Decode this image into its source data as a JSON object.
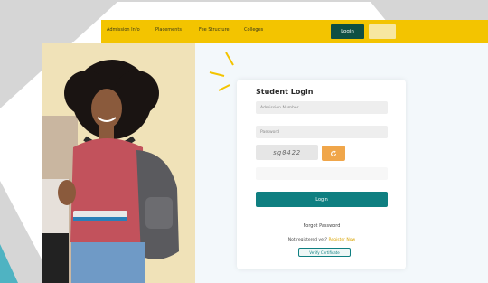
{
  "navbar": {
    "links": [
      "Admission Info",
      "Placements",
      "Fee Structure",
      "Colleges"
    ],
    "login_label": "Login"
  },
  "login_card": {
    "title": "Student Login",
    "username_placeholder": "Admission Number",
    "password_placeholder": "Password",
    "captcha_text": "sg0422",
    "submit_label": "Login",
    "forgot_label": "Forgot Password",
    "register_prefix": "Not registered yet?",
    "register_link": "Register Now",
    "secondary_button": "Verify Certificate"
  },
  "colors": {
    "navbar": "#f3c400",
    "login_button": "#0f4f43",
    "submit_button": "#0f7f81",
    "refresh_button": "#f0a64a"
  },
  "icons": [
    "refresh-icon"
  ]
}
